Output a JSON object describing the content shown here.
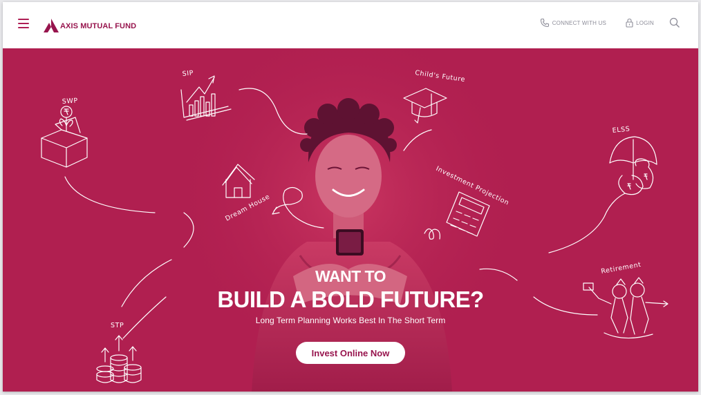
{
  "header": {
    "brand": "AXIS MUTUAL FUND",
    "connect_label": "CONNECT WITH US",
    "login_label": "LOGIN",
    "brand_color": "#97144d",
    "icons": [
      "hamburger-menu-icon",
      "phone-icon",
      "lock-icon",
      "search-icon"
    ]
  },
  "hero": {
    "headline_1": "WANT TO",
    "headline_2": "BUILD A BOLD FUTURE?",
    "subheadline": "Long Term Planning Works Best In The Short Term",
    "cta_label": "Invest Online Now",
    "background_color": "#b01f50",
    "doodles": {
      "sip": "SIP",
      "swp": "SWP",
      "stp": "STP",
      "childs_future": "Child's Future",
      "dream_house": "Dream House",
      "investment_projection": "Investment Projection",
      "elss": "ELSS",
      "retirement": "Retirement"
    }
  }
}
